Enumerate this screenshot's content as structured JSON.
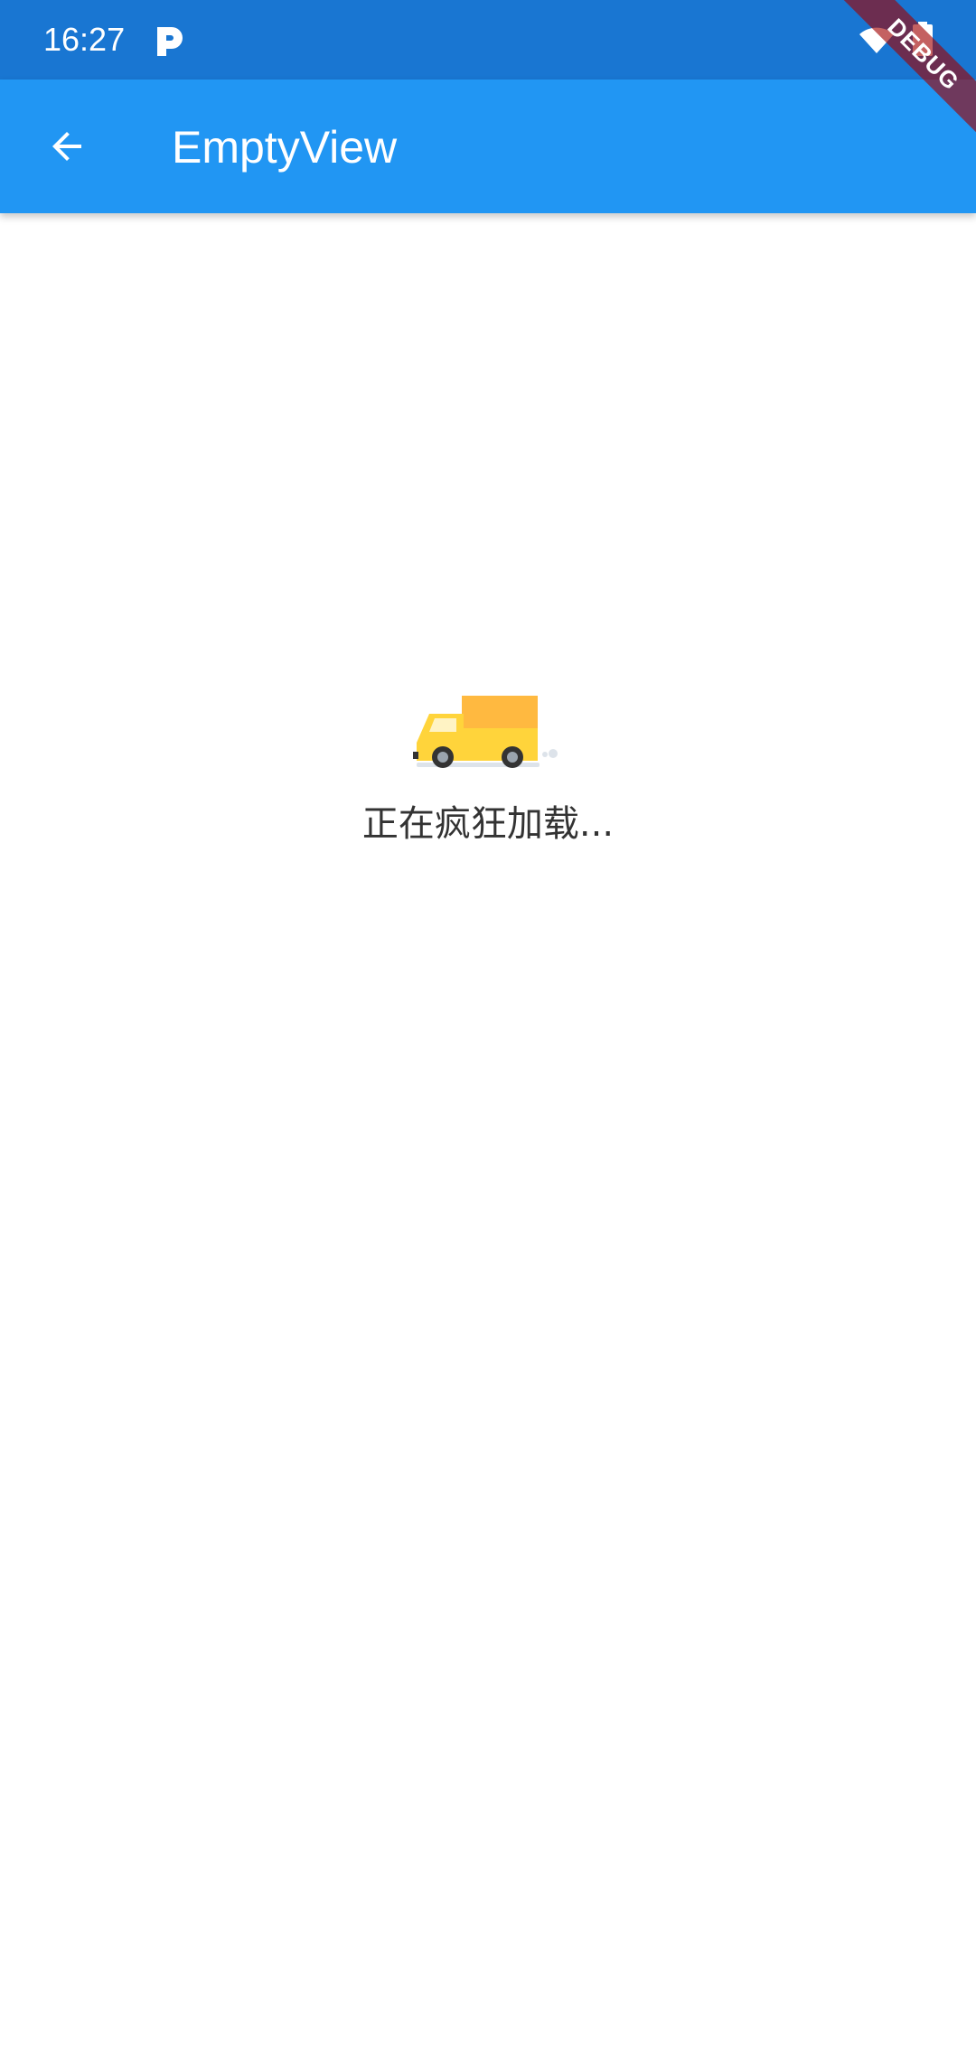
{
  "status_bar": {
    "time": "16:27",
    "icons": [
      "p-notification-icon",
      "wifi-icon",
      "battery-icon"
    ]
  },
  "app_bar": {
    "title": "EmptyView",
    "back_icon": "arrow-back-icon",
    "background_color": "#2196F3"
  },
  "debug_banner": {
    "label": "DEBUG"
  },
  "content": {
    "illustration": "delivery-truck-icon",
    "loading_text": "正在疯狂加载..."
  },
  "colors": {
    "status_bar": "#1976D2",
    "app_bar": "#2196F3",
    "truck_body": "#FFD43B",
    "truck_cargo": "#FFB940",
    "text": "#333333"
  }
}
